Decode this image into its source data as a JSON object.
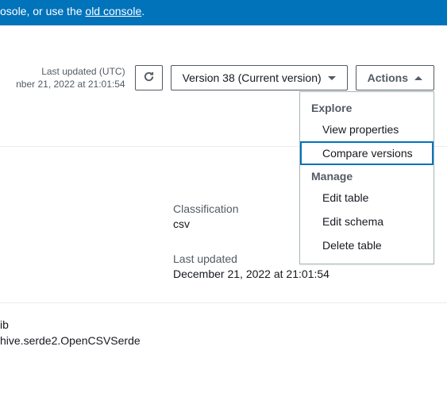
{
  "banner": {
    "prefix": "osole, or use the ",
    "linkText": "old console",
    "suffix": "."
  },
  "toolbar": {
    "lastUpdatedLabel": "Last updated (UTC)",
    "lastUpdatedValue": "nber 21, 2022 at 21:01:54",
    "versionLabel": "Version 38 (Current version)",
    "actionsLabel": "Actions"
  },
  "actionsMenu": {
    "sectionExplore": "Explore",
    "viewProperties": "View properties",
    "compareVersions": "Compare versions",
    "sectionManage": "Manage",
    "editTable": "Edit table",
    "editSchema": "Edit schema",
    "deleteTable": "Delete table"
  },
  "details": {
    "classificationLabel": "Classification",
    "classificationValue": "csv",
    "lastUpdatedLabel": "Last updated",
    "lastUpdatedValue": "December 21, 2022 at 21:01:54"
  },
  "bottom": {
    "line1": "ib",
    "line2": "hive.serde2.OpenCSVSerde"
  }
}
